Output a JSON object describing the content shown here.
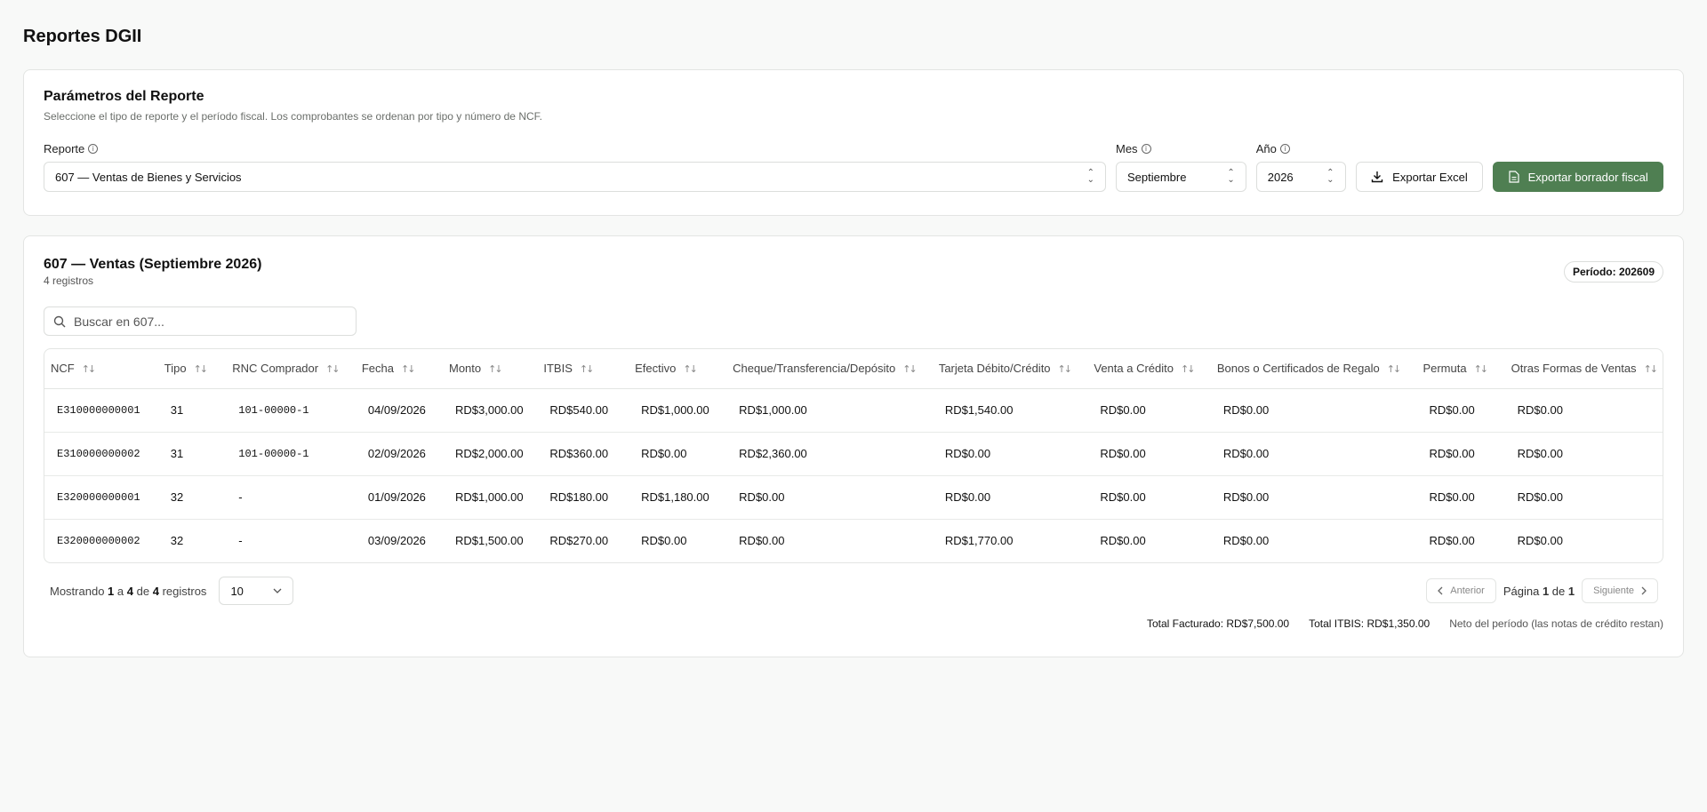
{
  "page": {
    "title": "Reportes DGII"
  },
  "params": {
    "title": "Parámetros del Reporte",
    "subtitle": "Seleccione el tipo de reporte y el período fiscal. Los comprobantes se ordenan por tipo y número de NCF.",
    "report_label": "Reporte",
    "report_value": "607 — Ventas de Bienes y Servicios",
    "month_label": "Mes",
    "month_value": "Septiembre",
    "year_label": "Año",
    "year_value": "2026",
    "export_excel_label": "Exportar Excel",
    "export_draft_label": "Exportar borrador fiscal",
    "colors": {
      "primary": "#4f7f52"
    }
  },
  "results": {
    "title": "607 — Ventas (Septiembre 2026)",
    "count": "4 registros",
    "period_badge": "Período: 202609",
    "search_placeholder": "Buscar en 607...",
    "columns": [
      "NCF",
      "Tipo",
      "RNC Comprador",
      "Fecha",
      "Monto",
      "ITBIS",
      "Efectivo",
      "Cheque/Transferencia/Depósito",
      "Tarjeta Débito/Crédito",
      "Venta a Crédito",
      "Bonos o Certificados de Regalo",
      "Permuta",
      "Otras Formas de Ventas"
    ],
    "rows": [
      [
        "E310000000001",
        "31",
        "101-00000-1",
        "04/09/2026",
        "RD$3,000.00",
        "RD$540.00",
        "RD$1,000.00",
        "RD$1,000.00",
        "RD$1,540.00",
        "RD$0.00",
        "RD$0.00",
        "RD$0.00",
        "RD$0.00"
      ],
      [
        "E310000000002",
        "31",
        "101-00000-1",
        "02/09/2026",
        "RD$2,000.00",
        "RD$360.00",
        "RD$0.00",
        "RD$2,360.00",
        "RD$0.00",
        "RD$0.00",
        "RD$0.00",
        "RD$0.00",
        "RD$0.00"
      ],
      [
        "E320000000001",
        "32",
        "-",
        "01/09/2026",
        "RD$1,000.00",
        "RD$180.00",
        "RD$1,180.00",
        "RD$0.00",
        "RD$0.00",
        "RD$0.00",
        "RD$0.00",
        "RD$0.00",
        "RD$0.00"
      ],
      [
        "E320000000002",
        "32",
        "-",
        "03/09/2026",
        "RD$1,500.00",
        "RD$270.00",
        "RD$0.00",
        "RD$0.00",
        "RD$1,770.00",
        "RD$0.00",
        "RD$0.00",
        "RD$0.00",
        "RD$0.00"
      ]
    ],
    "pagination": {
      "showing_prefix": "Mostrando",
      "from": "1",
      "a": "a",
      "to": "4",
      "de": "de",
      "total": "4",
      "suffix": "registros",
      "page_size": "10",
      "prev_label": "Anterior",
      "page_prefix": "Página",
      "page_current": "1",
      "page_de": "de",
      "page_total": "1",
      "next_label": "Siguiente"
    },
    "totals": {
      "invoiced": "Total Facturado: RD$7,500.00",
      "itbis": "Total ITBIS: RD$1,350.00",
      "note": "Neto del período (las notas de crédito restan)"
    }
  }
}
